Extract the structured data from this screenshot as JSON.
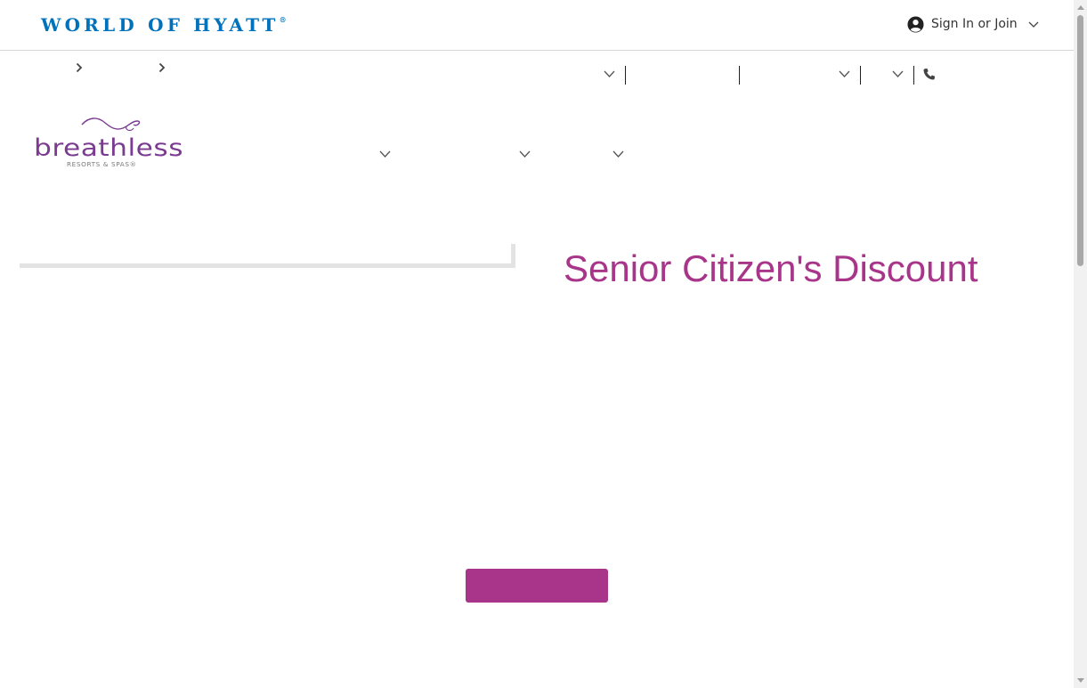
{
  "header": {
    "logo_text": "WORLD OF HYATT",
    "logo_mark": "®",
    "signin_label": "Sign In or Join",
    "brand_color": "#0072bb",
    "icons": {
      "account": "user-circle-icon",
      "menu": "chevron-down-icon"
    }
  },
  "brand": {
    "logo_text": "breathless",
    "logo_subtext": "RESORTS & SPAS®",
    "accent_color": "#a8358a"
  },
  "utility_nav": {
    "icons": [
      "chevron-down-icon",
      "chevron-down-icon",
      "chevron-down-icon",
      "phone-icon"
    ]
  },
  "offer": {
    "title": "Senior Citizen's Discount",
    "cta_color": "#a8358a"
  }
}
